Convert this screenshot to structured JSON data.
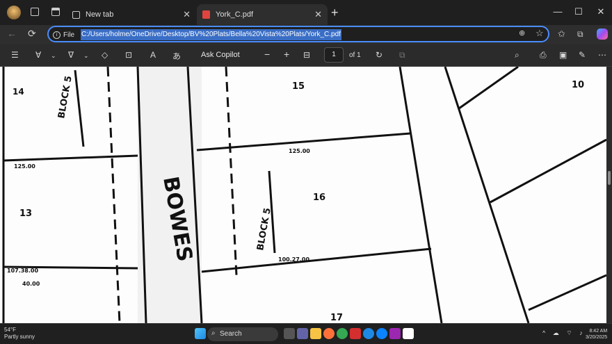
{
  "tabs": [
    {
      "title": "New tab"
    },
    {
      "title": "York_C.pdf"
    }
  ],
  "window_controls": {
    "minimize": "—",
    "maximize": "☐",
    "close": "✕"
  },
  "address": {
    "scheme_label": "File",
    "url": "C:/Users/holme/OneDrive/Desktop/BV%20Plats/Bella%20Vista%20Plats/York_C.pdf"
  },
  "pdf_toolbar": {
    "ask_copilot": "Ask Copilot",
    "zoom_out": "−",
    "zoom_in": "+",
    "page_current": "1",
    "page_of": "of 1"
  },
  "plat": {
    "street_name": "BOWES",
    "block_label_left": "BLOCK 5",
    "block_label_center": "BLOCK 5",
    "lot_numbers": [
      "14",
      "15",
      "16",
      "13",
      "17",
      "10"
    ],
    "dimensions": [
      "125.00",
      "125.00",
      "100.27.00",
      "107.38.00",
      "40.00"
    ]
  },
  "taskbar": {
    "search_placeholder": "Search",
    "weather_temp": "54°F",
    "weather_desc": "Partly sunny",
    "time": "8:42 AM",
    "date": "3/20/2025"
  },
  "colors": {
    "accent": "#4a8dff",
    "url_highlight": "#3a6ec5",
    "chrome_dark": "#1f1f1f",
    "toolbar": "#2b2b2b"
  }
}
